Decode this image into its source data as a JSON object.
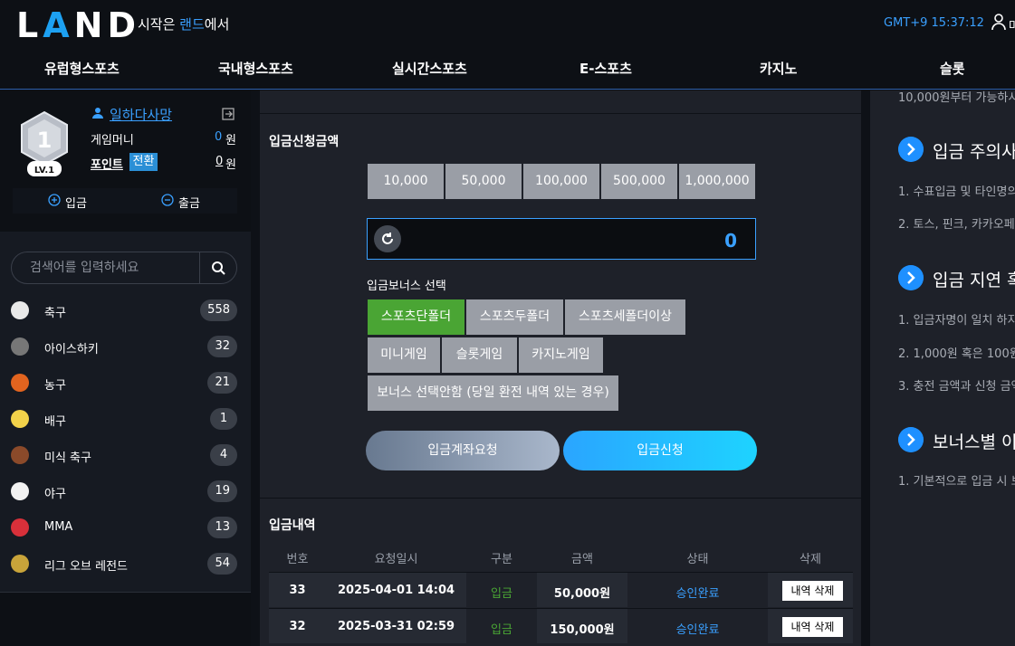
{
  "header": {
    "logo": "LAND",
    "tagline_prefix": "시작은 ",
    "tagline_hl": "랜드",
    "tagline_suffix": "에서",
    "clock": "GMT+9 15:37:12",
    "user_cut": "마"
  },
  "nav": [
    "유럽형스포츠",
    "국내형스포츠",
    "실시간스포츠",
    "E-스포츠",
    "카지노",
    "슬롯"
  ],
  "user": {
    "level_num": "1",
    "level_label": "LV.1",
    "name": "일하다사망",
    "game_money_label": "게임머니",
    "game_money": "0",
    "won": "원",
    "point_label": "포인트",
    "convert": "전환",
    "point": "0",
    "deposit": "입금",
    "withdraw": "출금"
  },
  "search": {
    "placeholder": "검색어를 입력하세요"
  },
  "sports": [
    {
      "name": "축구",
      "count": "558",
      "icon": "soccer-ball-icon",
      "color": "#e9e9e9"
    },
    {
      "name": "아이스하키",
      "count": "32",
      "icon": "hockey-puck-icon",
      "color": "#777777"
    },
    {
      "name": "농구",
      "count": "21",
      "icon": "basketball-icon",
      "color": "#e2641f"
    },
    {
      "name": "배구",
      "count": "1",
      "icon": "volleyball-icon",
      "color": "#f2d24a"
    },
    {
      "name": "미식 축구",
      "count": "4",
      "icon": "american-football-icon",
      "color": "#8b4a2a"
    },
    {
      "name": "야구",
      "count": "19",
      "icon": "baseball-icon",
      "color": "#f2f2f2"
    },
    {
      "name": "MMA",
      "count": "13",
      "icon": "boxing-glove-icon",
      "color": "#d8303a"
    },
    {
      "name": "리그 오브 레전드",
      "count": "54",
      "icon": "league-of-legends-icon",
      "color": "#c9a43a"
    }
  ],
  "deposit_form": {
    "title": "입금신청금액",
    "amounts": [
      "10,000",
      "50,000",
      "100,000",
      "500,000",
      "1,000,000"
    ],
    "amount_value": "0",
    "bonus_label": "입금보너스 선택",
    "bonuses": [
      "스포츠단폴더",
      "스포츠두폴더",
      "스포츠세폴더이상",
      "미니게임",
      "슬롯게임",
      "카지노게임",
      "보너스 선택안함 (당일 환전 내역 있는 경우)"
    ],
    "bonus_selected": "스포츠단폴더",
    "request_account": "입금계좌요청",
    "request": "입금신청"
  },
  "history": {
    "title": "입금내역",
    "columns": [
      "번호",
      "요청일시",
      "구분",
      "금액",
      "상태",
      "삭제"
    ],
    "rows": [
      {
        "no": "33",
        "date": "2025-04-01 14:04",
        "type": "입금",
        "amount": "50,000원",
        "status": "승인완료",
        "del": "내역 삭제"
      },
      {
        "no": "32",
        "date": "2025-03-31 02:59",
        "type": "입금",
        "amount": "150,000원",
        "status": "승인완료",
        "del": "내역 삭제"
      }
    ]
  },
  "notice": {
    "top_cut": "10,000원부터 가능하시",
    "sections": [
      {
        "title": "입금 주의사항",
        "lines": [
          "1. 수표입금 및 타인명의",
          "2. 토스, 핀크, 카카오페"
        ]
      },
      {
        "title": "입금 지연 혹",
        "lines": [
          "1. 입금자명이 일치 하지",
          "2. 1,000원 혹은 100원",
          "3. 충전 금액과 신청 금액"
        ]
      },
      {
        "title": "보너스별 이용",
        "lines": [
          "1. 기본적으로 입금 시 보"
        ]
      }
    ]
  },
  "colors": {
    "accent": "#3aa0ff",
    "selected_bonus": "#4aa534",
    "bg": "#0e1117"
  }
}
